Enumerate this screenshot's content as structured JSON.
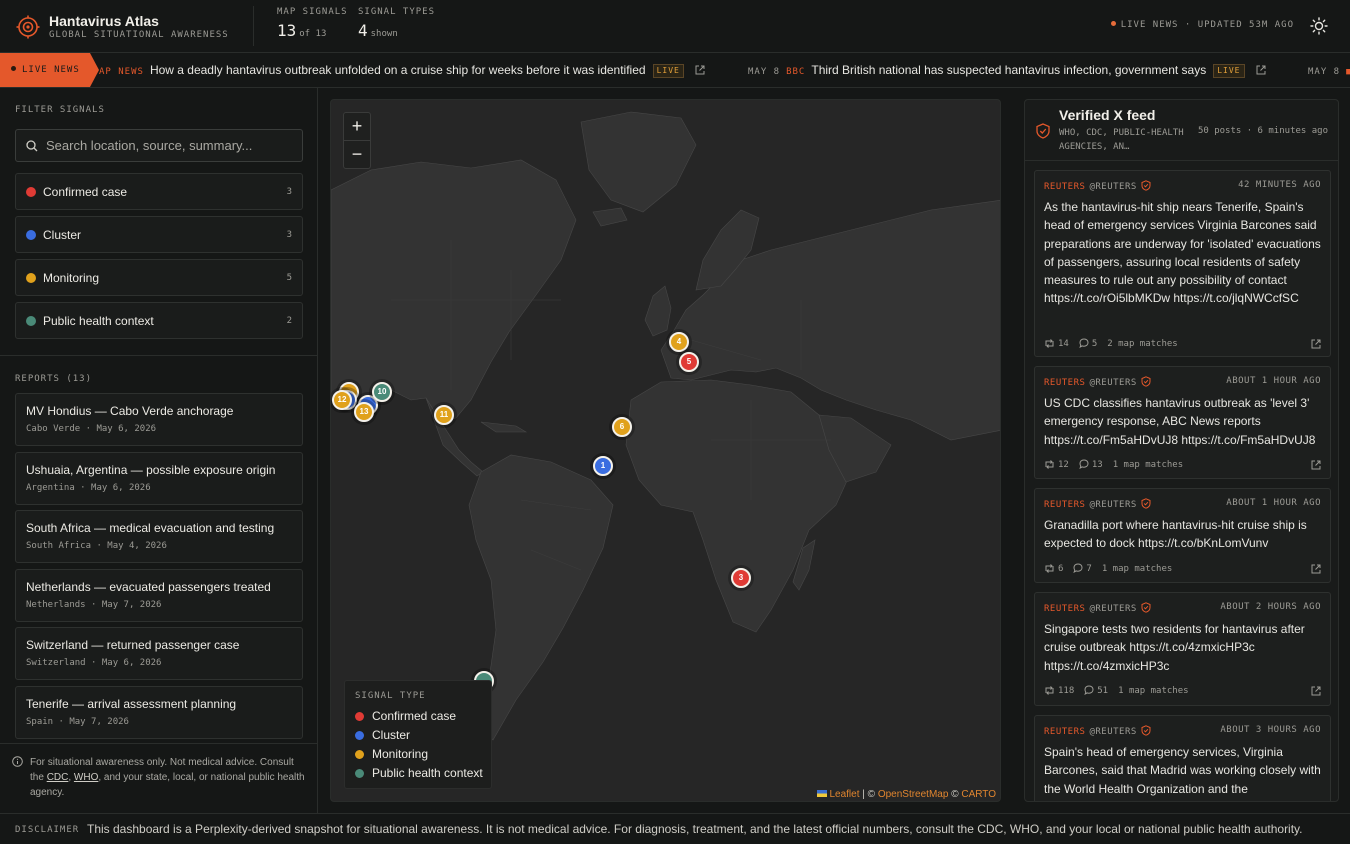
{
  "app": {
    "title": "Hantavirus Atlas",
    "subtitle": "GLOBAL SITUATIONAL AWARENESS"
  },
  "stats": {
    "map_signals": {
      "label": "MAP SIGNALS",
      "value": "13",
      "suffix": "of 13"
    },
    "signal_types": {
      "label": "SIGNAL TYPES",
      "value": "4",
      "suffix": "shown"
    }
  },
  "header": {
    "status": "LIVE NEWS · UPDATED 53M AGO",
    "theme_toggle": "sun-icon"
  },
  "ticker": {
    "badge": "LIVE NEWS",
    "items": [
      {
        "date": "",
        "source": "AP NEWS",
        "headline": "How a deadly hantavirus outbreak unfolded on a cruise ship for weeks before it was identified",
        "tag": "LIVE"
      },
      {
        "date": "MAY 8",
        "source": "BBC",
        "headline": "Third British national has suspected hantavirus infection, government says",
        "tag": "LIVE"
      },
      {
        "date": "MAY 8",
        "source": "",
        "headline": "",
        "tag": ""
      }
    ]
  },
  "sidebar": {
    "filter_label": "FILTER SIGNALS",
    "search_placeholder": "Search location, source, summary...",
    "filters": [
      {
        "label": "Confirmed case",
        "count": "3",
        "color": "#e03b35"
      },
      {
        "label": "Cluster",
        "count": "3",
        "color": "#3a6de0"
      },
      {
        "label": "Monitoring",
        "count": "5",
        "color": "#e0a11c"
      },
      {
        "label": "Public health context",
        "count": "2",
        "color": "#4a8a78"
      }
    ],
    "reports_label": "REPORTS (13)",
    "reports": [
      {
        "title": "MV Hondius — Cabo Verde anchorage",
        "meta": "Cabo Verde · May 6, 2026"
      },
      {
        "title": "Ushuaia, Argentina — possible exposure origin",
        "meta": "Argentina · May 6, 2026"
      },
      {
        "title": "South Africa — medical evacuation and testing",
        "meta": "South Africa · May 4, 2026"
      },
      {
        "title": "Netherlands — evacuated passengers treated",
        "meta": "Netherlands · May 7, 2026"
      },
      {
        "title": "Switzerland — returned passenger case",
        "meta": "Switzerland · May 6, 2026"
      },
      {
        "title": "Tenerife — arrival assessment planning",
        "meta": "Spain · May 7, 2026"
      }
    ],
    "note": {
      "pre": "For situational awareness only. Not medical advice. Consult the ",
      "link1": "CDC",
      "mid": ", ",
      "link2": "WHO",
      "post": ", and your state, local, or national public health agency."
    }
  },
  "map": {
    "zoom_in": "+",
    "zoom_out": "−",
    "markers": [
      {
        "label": "1",
        "type": "Cluster"
      },
      {
        "label": "3",
        "type": "Confirmed case"
      },
      {
        "label": "4",
        "type": "Monitoring"
      },
      {
        "label": "5",
        "type": "Confirmed case"
      },
      {
        "label": "6",
        "type": "Monitoring"
      },
      {
        "label": "10",
        "type": "Public health context"
      },
      {
        "label": "11",
        "type": "Monitoring"
      },
      {
        "label": "12",
        "type": "Monitoring"
      },
      {
        "label": "13",
        "type": "Monitoring"
      }
    ],
    "legend": {
      "title": "SIGNAL TYPE",
      "items": [
        "Confirmed case",
        "Cluster",
        "Monitoring",
        "Public health context"
      ]
    },
    "attribution": {
      "leaflet": "Leaflet",
      "osm": "OpenStreetMap",
      "carto": "CARTO"
    }
  },
  "feed": {
    "title": "Verified X feed",
    "sources": "WHO, CDC, PUBLIC-HEALTH AGENCIES, AN…",
    "meta": "50 posts · 6 minutes ago",
    "posts": [
      {
        "source": "REUTERS",
        "handle": "@REUTERS",
        "time": "42 MINUTES AGO",
        "text": "As the hantavirus-hit ship nears Tenerife, Spain's head of emergency services Virginia Barcones said preparations are underway for 'isolated' evacuations of passengers, assuring local residents of safety measures to rule out any possibility of contact https://t.co/rOi5lbMKDw https://t.co/jlqNWCcfSC",
        "reposts": "14",
        "replies": "5",
        "matches": "2 map matches"
      },
      {
        "source": "REUTERS",
        "handle": "@REUTERS",
        "time": "ABOUT 1 HOUR AGO",
        "text": "US CDC classifies hantavirus outbreak as 'level 3' emergency response, ABC News reports https://t.co/Fm5aHDvUJ8 https://t.co/Fm5aHDvUJ8",
        "reposts": "12",
        "replies": "13",
        "matches": "1 map matches"
      },
      {
        "source": "REUTERS",
        "handle": "@REUTERS",
        "time": "ABOUT 1 HOUR AGO",
        "text": "Granadilla port where hantavirus-hit cruise ship is expected to dock https://t.co/bKnLomVunv",
        "reposts": "6",
        "replies": "7",
        "matches": "1 map matches"
      },
      {
        "source": "REUTERS",
        "handle": "@REUTERS",
        "time": "ABOUT 2 HOURS AGO",
        "text": "Singapore tests two residents for hantavirus after cruise outbreak https://t.co/4zmxicHP3c https://t.co/4zmxicHP3c",
        "reposts": "118",
        "replies": "51",
        "matches": "1 map matches"
      },
      {
        "source": "REUTERS",
        "handle": "@REUTERS",
        "time": "ABOUT 3 HOURS AGO",
        "text": "Spain's head of emergency services, Virginia Barcones, said that Madrid was working closely with the World Health Organization and the",
        "reposts": "",
        "replies": "",
        "matches": ""
      }
    ]
  },
  "footer": {
    "label": "DISCLAIMER",
    "text": "This dashboard is a Perplexity-derived snapshot for situational awareness. It is not medical advice. For diagnosis, treatment, and the latest official numbers, consult the CDC, WHO, and your local or national public health authority."
  }
}
